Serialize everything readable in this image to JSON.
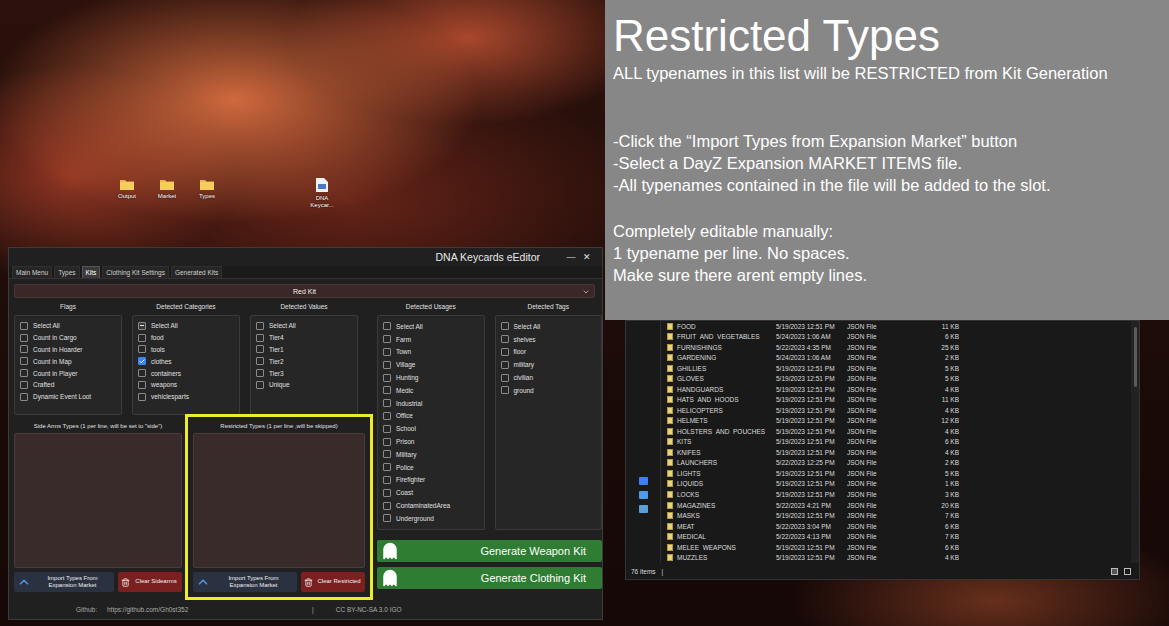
{
  "desktop": {
    "icons": [
      {
        "label": "Output",
        "kind": "folder"
      },
      {
        "label": "Market",
        "kind": "folder"
      },
      {
        "label": "Types",
        "kind": "folder"
      },
      {
        "label": "DNA Keycar...",
        "kind": "app"
      }
    ]
  },
  "slide": {
    "title": "Restricted Types",
    "lead": "ALL typenames in this list will be RESTRICTED from Kit Generation",
    "steps": [
      "-Click the “Import Types from Expansion Market” button",
      "-Select a DayZ Expansion MARKET ITEMS file.",
      "-All typenames contained in the file will be added to the slot."
    ],
    "notes": [
      "Completely editable manually:",
      "1 typename per line. No spaces.",
      "Make sure there arent empty lines."
    ]
  },
  "explorer": {
    "files": [
      {
        "name": "FOOD",
        "modified": "5/19/2023 12:51 PM",
        "type": "JSON File",
        "size": "11 KB"
      },
      {
        "name": "FRUIT_AND_VEGETABLES",
        "modified": "5/24/2023 1:06 AM",
        "type": "JSON File",
        "size": "6 KB"
      },
      {
        "name": "FURNISHINGS",
        "modified": "5/22/2023 4:35 PM",
        "type": "JSON File",
        "size": "25 KB"
      },
      {
        "name": "GARDENING",
        "modified": "5/24/2023 1:06 AM",
        "type": "JSON File",
        "size": "2 KB"
      },
      {
        "name": "GHILLIES",
        "modified": "5/19/2023 12:51 PM",
        "type": "JSON File",
        "size": "5 KB"
      },
      {
        "name": "GLOVES",
        "modified": "5/19/2023 12:51 PM",
        "type": "JSON File",
        "size": "5 KB"
      },
      {
        "name": "HANDGUARDS",
        "modified": "5/19/2023 12:51 PM",
        "type": "JSON File",
        "size": "4 KB"
      },
      {
        "name": "HATS_AND_HOODS",
        "modified": "5/19/2023 12:51 PM",
        "type": "JSON File",
        "size": "11 KB"
      },
      {
        "name": "HELICOPTERS",
        "modified": "5/19/2023 12:51 PM",
        "type": "JSON File",
        "size": "4 KB"
      },
      {
        "name": "HELMETS",
        "modified": "5/19/2023 12:51 PM",
        "type": "JSON File",
        "size": "12 KB"
      },
      {
        "name": "HOLSTERS_AND_POUCHES",
        "modified": "5/19/2023 12:51 PM",
        "type": "JSON File",
        "size": "4 KB"
      },
      {
        "name": "KITS",
        "modified": "5/19/2023 12:51 PM",
        "type": "JSON File",
        "size": "6 KB"
      },
      {
        "name": "KNIFES",
        "modified": "5/19/2023 12:51 PM",
        "type": "JSON File",
        "size": "4 KB"
      },
      {
        "name": "LAUNCHERS",
        "modified": "5/22/2023 12:25 PM",
        "type": "JSON File",
        "size": "2 KB"
      },
      {
        "name": "LIGHTS",
        "modified": "5/19/2023 12:51 PM",
        "type": "JSON File",
        "size": "5 KB"
      },
      {
        "name": "LIQUIDS",
        "modified": "5/19/2023 12:51 PM",
        "type": "JSON File",
        "size": "1 KB"
      },
      {
        "name": "LOCKS",
        "modified": "5/19/2023 12:51 PM",
        "type": "JSON File",
        "size": "3 KB"
      },
      {
        "name": "MAGAZINES",
        "modified": "5/22/2023 4:21 PM",
        "type": "JSON File",
        "size": "20 KB"
      },
      {
        "name": "MASKS",
        "modified": "5/19/2023 12:51 PM",
        "type": "JSON File",
        "size": "7 KB"
      },
      {
        "name": "MEAT",
        "modified": "5/22/2023 3:04 PM",
        "type": "JSON File",
        "size": "6 KB"
      },
      {
        "name": "MEDICAL",
        "modified": "5/22/2023 4:13 PM",
        "type": "JSON File",
        "size": "7 KB"
      },
      {
        "name": "MELEE_WEAPONS",
        "modified": "5/19/2023 12:51 PM",
        "type": "JSON File",
        "size": "6 KB"
      },
      {
        "name": "MUZZLES",
        "modified": "5/19/2023 12:51 PM",
        "type": "JSON File",
        "size": "4 KB"
      }
    ],
    "status": "76 items",
    "status_separator": "|"
  },
  "app": {
    "title": "DNA Keycards eEditor",
    "controls": [
      "—",
      "✕"
    ],
    "tabs": [
      {
        "label": "Main Menu",
        "selected": false
      },
      {
        "label": "Types",
        "selected": false
      },
      {
        "label": "Kits",
        "selected": true
      },
      {
        "label": "Clothing Kit Settings",
        "selected": false
      },
      {
        "label": "Generated Kits",
        "selected": false
      }
    ],
    "kit_select": {
      "value": "Red Kit"
    },
    "filters": [
      {
        "heading": "Flags",
        "items": [
          {
            "label": "Select All",
            "checked": false,
            "mixed": false
          },
          {
            "label": "Count in Cargo",
            "checked": false,
            "mixed": false
          },
          {
            "label": "Count in Hoarder",
            "checked": false,
            "mixed": false
          },
          {
            "label": "Count in Map",
            "checked": false,
            "mixed": false
          },
          {
            "label": "Count in Player",
            "checked": false,
            "mixed": false
          },
          {
            "label": "Crafted",
            "checked": false,
            "mixed": false
          },
          {
            "label": "Dynamic Event Loot",
            "checked": false,
            "mixed": false
          }
        ]
      },
      {
        "heading": "Detected Categories",
        "items": [
          {
            "label": "Select All",
            "checked": false,
            "mixed": true
          },
          {
            "label": "food",
            "checked": false,
            "mixed": false
          },
          {
            "label": "tools",
            "checked": false,
            "mixed": false
          },
          {
            "label": "clothes",
            "checked": true,
            "mixed": false
          },
          {
            "label": "containers",
            "checked": false,
            "mixed": false
          },
          {
            "label": "weapons",
            "checked": false,
            "mixed": false
          },
          {
            "label": "vehiclesparts",
            "checked": false,
            "mixed": false
          }
        ]
      },
      {
        "heading": "Detected Values",
        "items": [
          {
            "label": "Select All",
            "checked": false,
            "mixed": false
          },
          {
            "label": "Tier4",
            "checked": false,
            "mixed": false
          },
          {
            "label": "Tier1",
            "checked": false,
            "mixed": false
          },
          {
            "label": "Tier2",
            "checked": false,
            "mixed": false
          },
          {
            "label": "Tier3",
            "checked": false,
            "mixed": false
          },
          {
            "label": "Unique",
            "checked": false,
            "mixed": false
          }
        ]
      },
      {
        "heading": "Detected Usages",
        "items": [
          {
            "label": "Select All",
            "checked": false,
            "mixed": false
          },
          {
            "label": "Farm",
            "checked": false,
            "mixed": false
          },
          {
            "label": "Town",
            "checked": false,
            "mixed": false
          },
          {
            "label": "Village",
            "checked": false,
            "mixed": false
          },
          {
            "label": "Hunting",
            "checked": false,
            "mixed": false
          },
          {
            "label": "Medic",
            "checked": false,
            "mixed": false
          },
          {
            "label": "Industrial",
            "checked": false,
            "mixed": false
          },
          {
            "label": "Office",
            "checked": false,
            "mixed": false
          },
          {
            "label": "School",
            "checked": false,
            "mixed": false
          },
          {
            "label": "Prison",
            "checked": false,
            "mixed": false
          },
          {
            "label": "Military",
            "checked": false,
            "mixed": false
          },
          {
            "label": "Police",
            "checked": false,
            "mixed": false
          },
          {
            "label": "Firefighter",
            "checked": false,
            "mixed": false
          },
          {
            "label": "Coast",
            "checked": false,
            "mixed": false
          },
          {
            "label": "ContaminatedArea",
            "checked": false,
            "mixed": false
          },
          {
            "label": "Underground",
            "checked": false,
            "mixed": false
          }
        ]
      },
      {
        "heading": "Detected Tags",
        "items": [
          {
            "label": "Select All",
            "checked": false,
            "mixed": false
          },
          {
            "label": "shelves",
            "checked": false,
            "mixed": false
          },
          {
            "label": "floor",
            "checked": false,
            "mixed": false
          },
          {
            "label": "military",
            "checked": false,
            "mixed": false
          },
          {
            "label": "civilian",
            "checked": false,
            "mixed": false
          },
          {
            "label": "ground",
            "checked": false,
            "mixed": false
          }
        ]
      }
    ],
    "type_lists": [
      {
        "heading": "Side Arms Types (1 per line, will be set to \"side\")",
        "text": "",
        "highlighted": false,
        "buttons": [
          {
            "label": "Import Types From Expansion Market",
            "kind": "import"
          },
          {
            "label": "Clear Sidearms",
            "kind": "clear"
          }
        ]
      },
      {
        "heading": "Restricted Types (1 per line ,will be skipped)",
        "text": "",
        "highlighted": true,
        "buttons": [
          {
            "label": "Import Types From Expansion Market",
            "kind": "import"
          },
          {
            "label": "Clear Restricted",
            "kind": "clear"
          }
        ]
      }
    ],
    "generate_buttons": [
      {
        "label": "Generate Weapon Kit"
      },
      {
        "label": "Generate Clothing Kit"
      }
    ],
    "footer": {
      "github_label": "Github:",
      "github_url": "https://github.com/Gh0st352",
      "separator": "|",
      "license": "CC BY-NC-SA 3.0 IGO"
    }
  }
}
